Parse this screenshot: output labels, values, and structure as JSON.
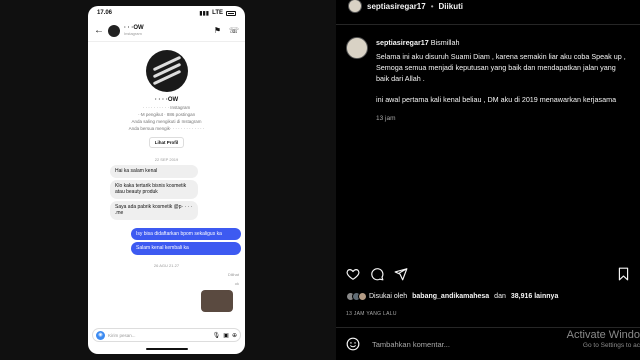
{
  "phone": {
    "status_time": "17.06",
    "status_network": "LTE",
    "chat_name": "· · ·OW",
    "chat_sub": "Instagram",
    "profile_name": "· · · ·OW",
    "profile_line1": "· · · · · · · · · · Instagram",
    "profile_line2": "··M pengikut · 886 postingan",
    "profile_line3": "Anda saling mengikuti di Instagram",
    "profile_line4": "Anda bersua mengik· · · · · · · · · · · · ·",
    "profile_button": "Lihat Profil",
    "timestamp_1": "22 SEP 2019",
    "msg_in_1": "Hai ka salam kenal",
    "msg_in_2": "Klo kaka tertarik bisnis kosmetik atau beauty produk",
    "msg_in_3": "Saya ada pabrik kosmetik @p· · · · .me",
    "msg_out_1": "Isy bisa didaftarkan bpom sekaligus ka",
    "msg_out_2": "Salam kenal kembali ka",
    "timestamp_2": "26 AGU 21.27",
    "seen_1": "Dilihat",
    "seen_2": "ok",
    "composer_placeholder": "Kirim pesan..."
  },
  "post": {
    "username": "septiasiregar17",
    "follow_state": "Diikuti",
    "caption_intro": "Bismillah",
    "caption_p1": "Selama ini aku disuruh Suami Diam , karena semakin liar aku coba Speak up , Semoga semua menjadi keputusan yang baik dan mendapatkan jalan yang baik dari Allah .",
    "caption_p2": "ini awal pertama kali kenal beliau , DM aku di 2019 menawarkan kerjasama",
    "caption_time": "13 jam",
    "liked_prefix": "Disukai oleh",
    "liked_user": "babang_andikamahesa",
    "liked_and": "dan",
    "liked_count": "38,916 lainnya",
    "date": "13 JAM YANG LALU",
    "comment_placeholder": "Tambahkan komentar..."
  },
  "watermark": {
    "line1": "Activate Windo",
    "line2": "Go to Settings to ac"
  }
}
